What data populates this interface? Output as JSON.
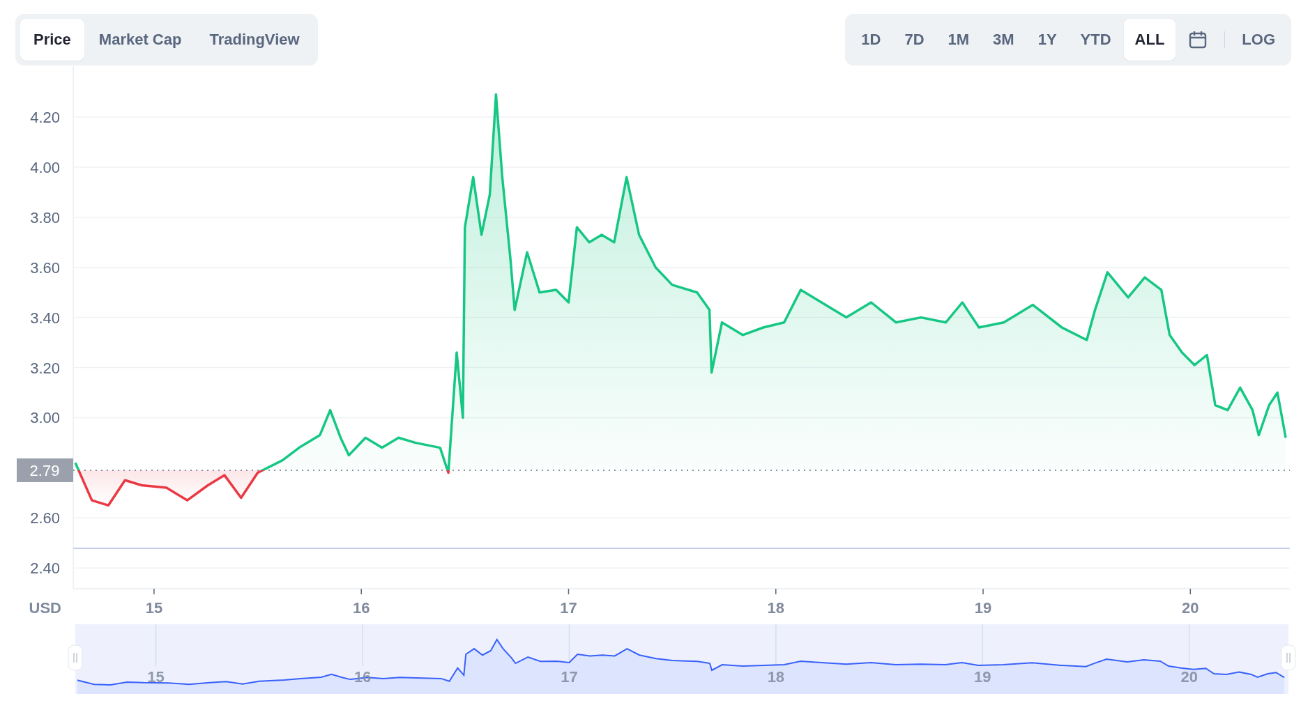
{
  "view_tabs": [
    {
      "label": "Price",
      "selected": true
    },
    {
      "label": "Market Cap",
      "selected": false
    },
    {
      "label": "TradingView",
      "selected": false
    }
  ],
  "range_buttons": [
    {
      "kind": "text",
      "label": "1D",
      "selected": false
    },
    {
      "kind": "text",
      "label": "7D",
      "selected": false
    },
    {
      "kind": "text",
      "label": "1M",
      "selected": false
    },
    {
      "kind": "text",
      "label": "3M",
      "selected": false
    },
    {
      "kind": "text",
      "label": "1Y",
      "selected": false
    },
    {
      "kind": "text",
      "label": "YTD",
      "selected": false
    },
    {
      "kind": "text",
      "label": "ALL",
      "selected": true
    },
    {
      "kind": "calendar",
      "selected": false
    },
    {
      "kind": "divider"
    },
    {
      "kind": "text",
      "label": "LOG",
      "selected": false
    }
  ],
  "chart": {
    "chart_data": {
      "type": "area",
      "ylabel": "USD",
      "x": [
        14.62,
        14.7,
        14.78,
        14.86,
        14.94,
        15.06,
        15.16,
        15.26,
        15.34,
        15.42,
        15.5,
        15.62,
        15.7,
        15.8,
        15.85,
        15.9,
        15.94,
        16.02,
        16.1,
        16.18,
        16.26,
        16.38,
        16.42,
        16.46,
        16.49,
        16.5,
        16.54,
        16.58,
        16.62,
        16.65,
        16.68,
        16.72,
        16.74,
        16.8,
        16.86,
        16.94,
        17.0,
        17.04,
        17.1,
        17.16,
        17.22,
        17.28,
        17.34,
        17.42,
        17.5,
        17.62,
        17.68,
        17.69,
        17.74,
        17.84,
        17.94,
        18.04,
        18.12,
        18.22,
        18.34,
        18.46,
        18.58,
        18.7,
        18.82,
        18.9,
        18.98,
        19.1,
        19.24,
        19.38,
        19.5,
        19.54,
        19.6,
        19.7,
        19.78,
        19.86,
        19.9,
        19.96,
        20.02,
        20.08,
        20.12,
        20.18,
        20.24,
        20.3,
        20.33,
        20.38,
        20.42,
        20.46
      ],
      "series": [
        {
          "color": "#16c784",
          "values": [
            2.82,
            2.67,
            2.65,
            2.75,
            2.73,
            2.72,
            2.67,
            2.73,
            2.77,
            2.68,
            2.78,
            2.83,
            2.88,
            2.93,
            3.03,
            2.92,
            2.85,
            2.92,
            2.88,
            2.92,
            2.9,
            2.88,
            2.78,
            3.26,
            3.0,
            3.76,
            3.96,
            3.73,
            3.89,
            4.29,
            3.96,
            3.63,
            3.43,
            3.66,
            3.5,
            3.51,
            3.46,
            3.76,
            3.7,
            3.73,
            3.7,
            3.96,
            3.73,
            3.6,
            3.53,
            3.5,
            3.43,
            3.18,
            3.38,
            3.33,
            3.36,
            3.38,
            3.51,
            3.46,
            3.4,
            3.46,
            3.38,
            3.4,
            3.38,
            3.46,
            3.36,
            3.38,
            3.45,
            3.36,
            3.31,
            3.43,
            3.58,
            3.48,
            3.56,
            3.51,
            3.33,
            3.26,
            3.21,
            3.25,
            3.05,
            3.03,
            3.12,
            3.03,
            2.93,
            3.05,
            3.1,
            2.92
          ]
        }
      ],
      "xlim": [
        14.61,
        20.48
      ],
      "ylim": [
        2.317,
        4.403
      ],
      "xticks": [
        {
          "value": 15,
          "label": "15"
        },
        {
          "value": 16,
          "label": "16"
        },
        {
          "value": 17,
          "label": "17"
        },
        {
          "value": 18,
          "label": "18"
        },
        {
          "value": 19,
          "label": "19"
        },
        {
          "value": 20,
          "label": "20"
        }
      ],
      "grid": true,
      "yticks": [
        {
          "value": 2.4,
          "label": "2.40"
        },
        {
          "value": 2.6,
          "label": "2.60"
        },
        {
          "value": 3.0,
          "label": "3.00"
        },
        {
          "value": 3.2,
          "label": "3.20"
        },
        {
          "value": 3.4,
          "label": "3.40"
        },
        {
          "value": 3.6,
          "label": "3.60"
        },
        {
          "value": 3.8,
          "label": "3.80"
        },
        {
          "value": 4.0,
          "label": "4.00"
        },
        {
          "value": 4.2,
          "label": "4.20"
        }
      ],
      "ref_lines": [
        {
          "axis": "y",
          "value": 2.79,
          "label": "2.79"
        },
        {
          "axis": "y",
          "value": 2.478
        }
      ]
    }
  },
  "navigator": {
    "labels": [
      "15",
      "16",
      "17",
      "18",
      "19",
      "20"
    ]
  }
}
